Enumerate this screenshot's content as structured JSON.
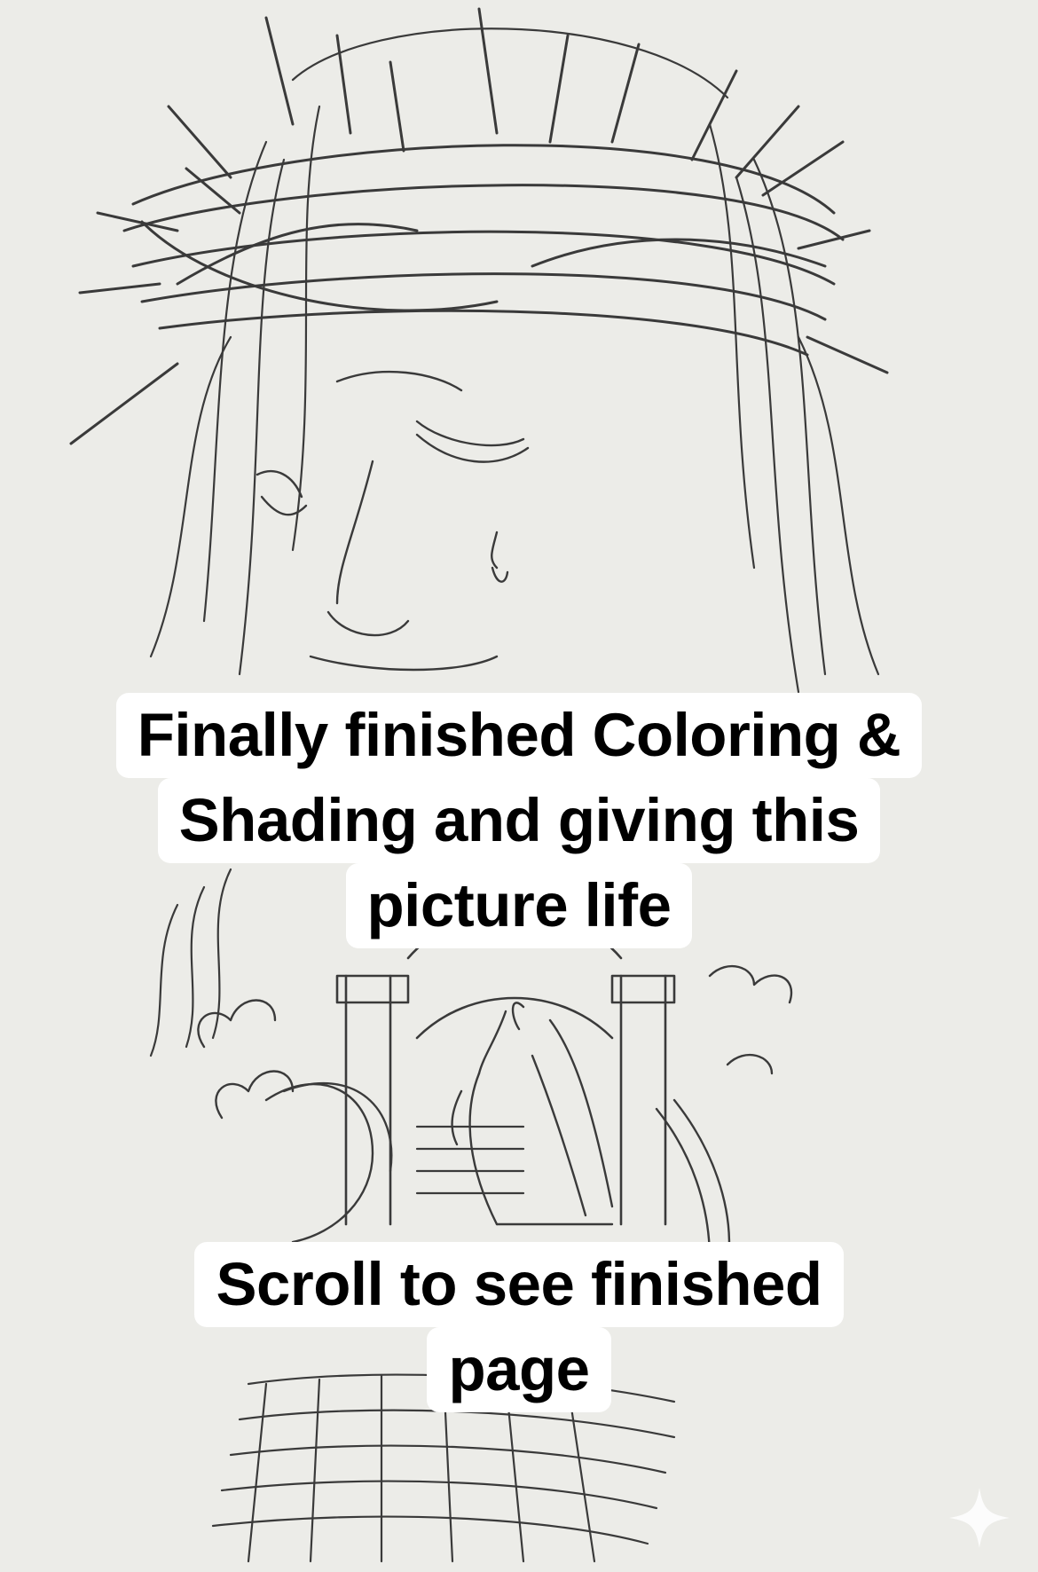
{
  "overlay_captions": {
    "top_lines": [
      "Finally finished Coloring &",
      "Shading and giving this",
      "picture life"
    ],
    "bottom_lines": [
      "Scroll to see finished",
      "page"
    ]
  },
  "artwork": {
    "subject": "line-art coloring page: thorn-crowned face above, robed figure ascending stairs under arches below",
    "line_color": "#3a3a3a",
    "paper_color": "#ecece8"
  },
  "icons": [
    "sparkle-icon"
  ]
}
